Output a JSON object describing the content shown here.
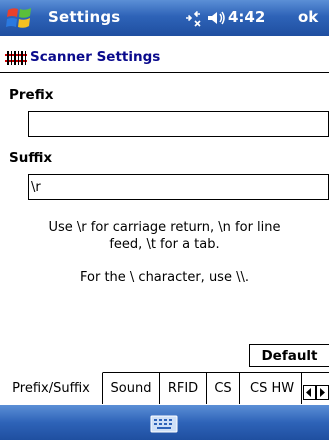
{
  "titlebar": {
    "title": "Settings",
    "time": "4:42",
    "ok_label": "ok"
  },
  "header": {
    "title": "Scanner Settings"
  },
  "prefix": {
    "label": "Prefix",
    "value": ""
  },
  "suffix": {
    "label": "Suffix",
    "value": "\\r"
  },
  "help": {
    "line1": "Use \\r for carriage return, \\n for line",
    "line2": "feed, \\t for a tab.",
    "line3": "For the \\ character, use \\\\."
  },
  "default_label": "Default",
  "tabs": [
    {
      "label": "Prefix/Suffix",
      "active": true
    },
    {
      "label": "Sound",
      "active": false
    },
    {
      "label": "RFID",
      "active": false
    },
    {
      "label": "CS",
      "active": false
    },
    {
      "label": "CS HW",
      "active": false
    }
  ],
  "colors": {
    "bar_blue": "#2e63b8",
    "header_text": "#0a0a8c"
  },
  "icons": [
    "windows-start-icon",
    "connectivity-icon",
    "speaker-icon",
    "scanner-app-icon",
    "scroll-left-icon",
    "scroll-right-icon",
    "keyboard-icon"
  ]
}
